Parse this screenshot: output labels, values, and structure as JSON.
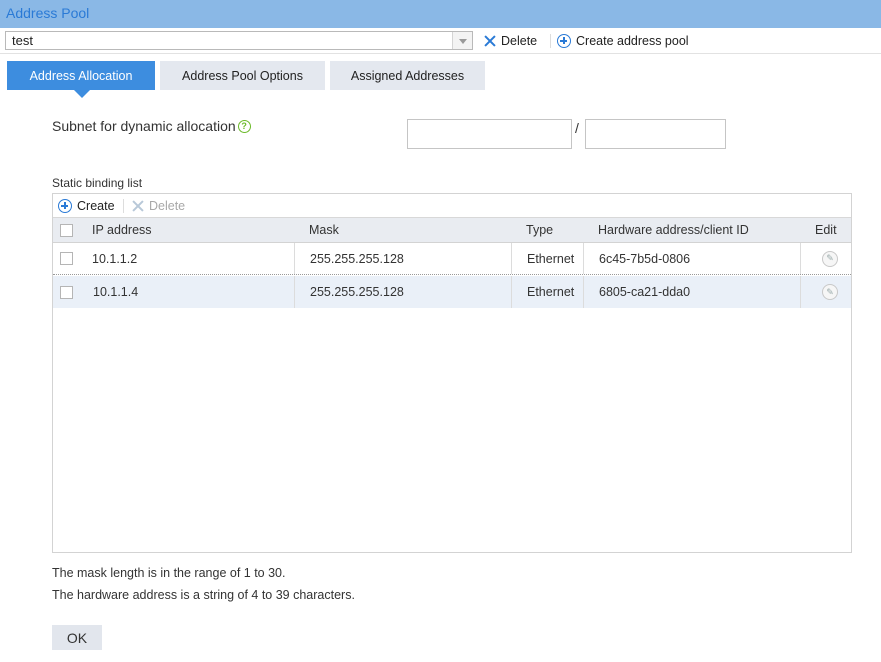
{
  "window": {
    "title": "Address Pool"
  },
  "toolbar": {
    "selected_pool": "test",
    "delete_label": "Delete",
    "create_label": "Create address pool"
  },
  "tabs": [
    {
      "label": "Address Allocation",
      "active": true
    },
    {
      "label": "Address Pool Options",
      "active": false
    },
    {
      "label": "Assigned Addresses",
      "active": false
    }
  ],
  "subnet": {
    "label": "Subnet for dynamic allocation",
    "ip_value": "",
    "separator": "/",
    "mask_value": ""
  },
  "static_list": {
    "label": "Static binding list",
    "create_label": "Create",
    "delete_label": "Delete",
    "columns": [
      "IP address",
      "Mask",
      "Type",
      "Hardware address/client ID",
      "Edit"
    ],
    "rows": [
      {
        "ip": "10.1.1.2",
        "mask": "255.255.255.128",
        "type": "Ethernet",
        "hw": "6c45-7b5d-0806"
      },
      {
        "ip": "10.1.1.4",
        "mask": "255.255.255.128",
        "type": "Ethernet",
        "hw": "6805-ca21-dda0"
      }
    ]
  },
  "notes": {
    "mask_note": "The mask length is in the range of 1 to 30.",
    "hw_note": "The hardware address is a string of 4 to 39 characters."
  },
  "ok_label": "OK",
  "colors": {
    "title_bar": "#8ab8e6",
    "accent": "#3d8ddf",
    "help": "#6cba2a"
  }
}
